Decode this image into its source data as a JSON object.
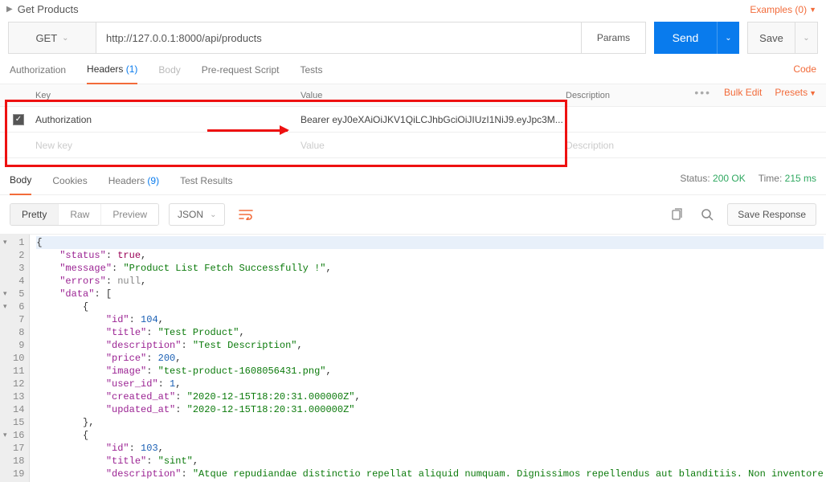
{
  "title": "Get Products",
  "examples": {
    "label": "Examples (0)"
  },
  "request": {
    "method": "GET",
    "url": "http://127.0.0.1:8000/api/products",
    "params_label": "Params",
    "send_label": "Send",
    "save_label": "Save"
  },
  "tabs": {
    "authorization": "Authorization",
    "headers": "Headers",
    "headers_count": "(1)",
    "body": "Body",
    "pre_request": "Pre-request Script",
    "tests": "Tests",
    "code": "Code"
  },
  "headers_table": {
    "cols": {
      "key": "Key",
      "value": "Value",
      "description": "Description"
    },
    "row": {
      "key": "Authorization",
      "value": "Bearer eyJ0eXAiOiJKV1QiLCJhbGciOiJIUzI1NiJ9.eyJpc3M..."
    },
    "placeholder": {
      "key": "New key",
      "value": "Value",
      "description": "Description"
    },
    "bulk_edit": "Bulk Edit",
    "presets": "Presets"
  },
  "response": {
    "tabs": {
      "body": "Body",
      "cookies": "Cookies",
      "headers": "Headers",
      "headers_count": "(9)",
      "test_results": "Test Results"
    },
    "status_label": "Status:",
    "status_value": "200 OK",
    "time_label": "Time:",
    "time_value": "215 ms",
    "viewer": {
      "pretty": "Pretty",
      "raw": "Raw",
      "preview": "Preview",
      "format": "JSON",
      "save_response": "Save Response"
    }
  },
  "json_body": {
    "lines": [
      {
        "n": 1,
        "fold": true,
        "indent": 0,
        "raw": "{"
      },
      {
        "n": 2,
        "indent": 1,
        "key": "\"status\"",
        "sep": ": ",
        "val": "true",
        "type": "b",
        "comma": ","
      },
      {
        "n": 3,
        "indent": 1,
        "key": "\"message\"",
        "sep": ": ",
        "val": "\"Product List Fetch Successfully !\"",
        "type": "s",
        "comma": ","
      },
      {
        "n": 4,
        "indent": 1,
        "key": "\"errors\"",
        "sep": ": ",
        "val": "null",
        "type": "nu",
        "comma": ","
      },
      {
        "n": 5,
        "fold": true,
        "indent": 1,
        "key": "\"data\"",
        "sep": ": ",
        "raw": "["
      },
      {
        "n": 6,
        "fold": true,
        "indent": 2,
        "raw": "{"
      },
      {
        "n": 7,
        "indent": 3,
        "key": "\"id\"",
        "sep": ": ",
        "val": "104",
        "type": "n",
        "comma": ","
      },
      {
        "n": 8,
        "indent": 3,
        "key": "\"title\"",
        "sep": ": ",
        "val": "\"Test Product\"",
        "type": "s",
        "comma": ","
      },
      {
        "n": 9,
        "indent": 3,
        "key": "\"description\"",
        "sep": ": ",
        "val": "\"Test Description\"",
        "type": "s",
        "comma": ","
      },
      {
        "n": 10,
        "indent": 3,
        "key": "\"price\"",
        "sep": ": ",
        "val": "200",
        "type": "n",
        "comma": ","
      },
      {
        "n": 11,
        "indent": 3,
        "key": "\"image\"",
        "sep": ": ",
        "val": "\"test-product-1608056431.png\"",
        "type": "s",
        "comma": ","
      },
      {
        "n": 12,
        "indent": 3,
        "key": "\"user_id\"",
        "sep": ": ",
        "val": "1",
        "type": "n",
        "comma": ","
      },
      {
        "n": 13,
        "indent": 3,
        "key": "\"created_at\"",
        "sep": ": ",
        "val": "\"2020-12-15T18:20:31.000000Z\"",
        "type": "s",
        "comma": ","
      },
      {
        "n": 14,
        "indent": 3,
        "key": "\"updated_at\"",
        "sep": ": ",
        "val": "\"2020-12-15T18:20:31.000000Z\"",
        "type": "s"
      },
      {
        "n": 15,
        "indent": 2,
        "raw": "},"
      },
      {
        "n": 16,
        "fold": true,
        "indent": 2,
        "raw": "{"
      },
      {
        "n": 17,
        "indent": 3,
        "key": "\"id\"",
        "sep": ": ",
        "val": "103",
        "type": "n",
        "comma": ","
      },
      {
        "n": 18,
        "indent": 3,
        "key": "\"title\"",
        "sep": ": ",
        "val": "\"sint\"",
        "type": "s",
        "comma": ","
      },
      {
        "n": 19,
        "indent": 3,
        "key": "\"description\"",
        "sep": ": ",
        "val": "\"Atque repudiandae distinctio repellat aliquid numquam. Dignissimos repellendus aut blanditiis. Non inventore",
        "type": "s"
      }
    ]
  }
}
